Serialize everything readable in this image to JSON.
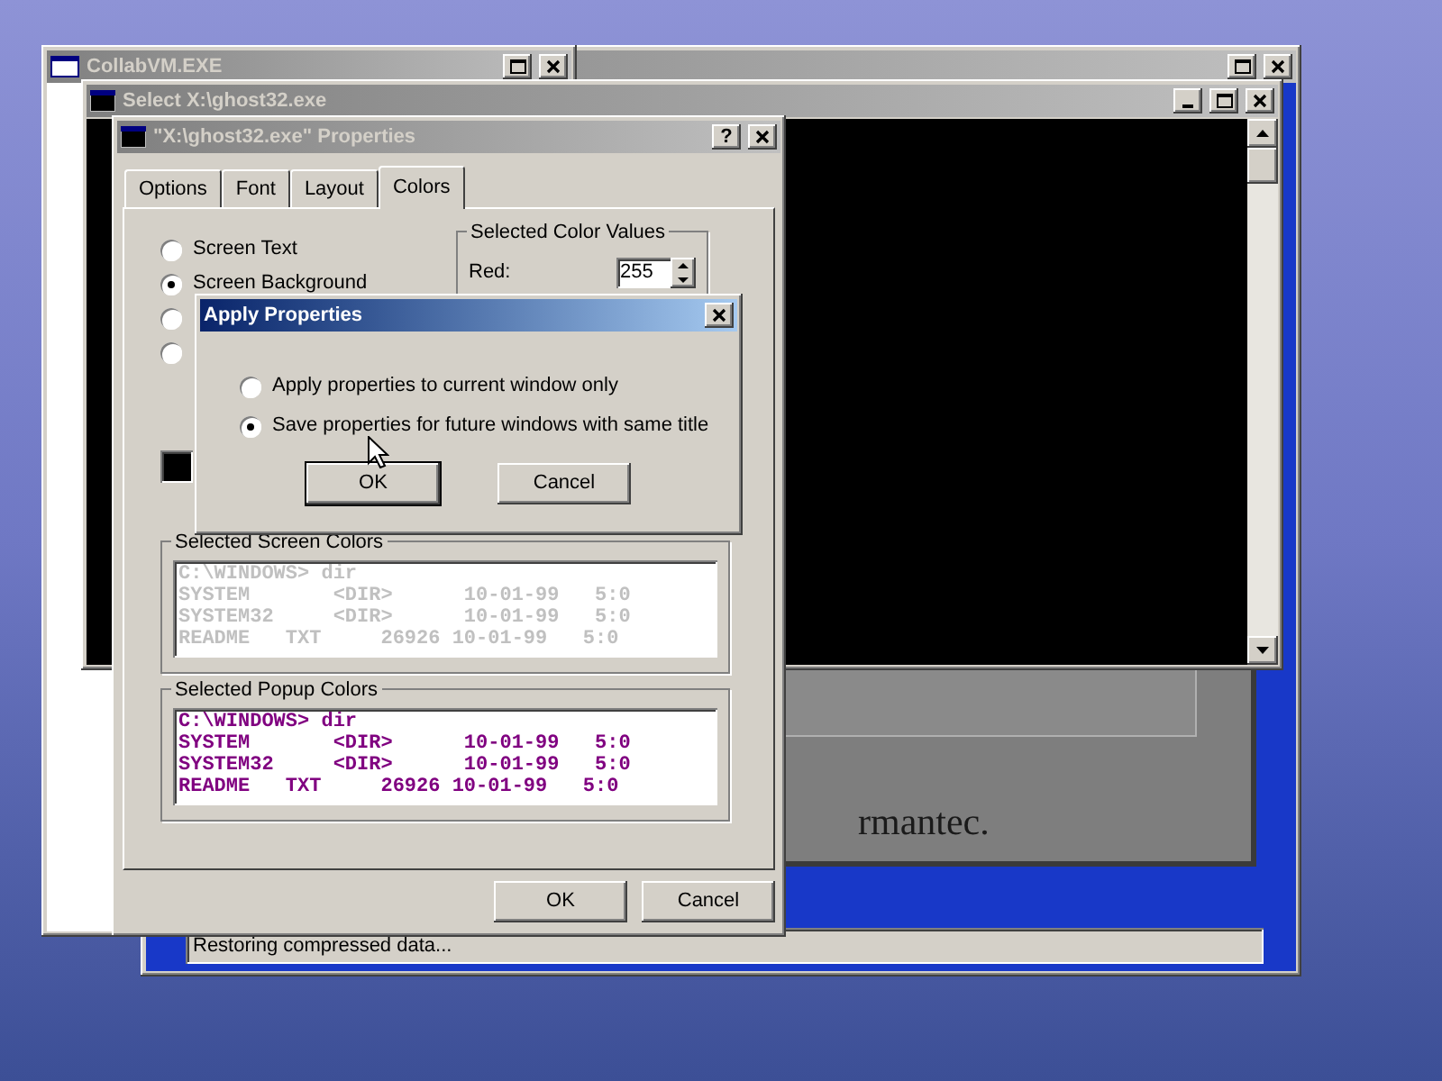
{
  "collab_window": {
    "title": "CollabVM.EXE",
    "active": false
  },
  "ghost_window": {
    "active": false,
    "logo_text": "rmantec.",
    "status": "Restoring compressed data..."
  },
  "console_window": {
    "title": "Select X:\\ghost32.exe",
    "active": false
  },
  "properties_window": {
    "title": "\"X:\\ghost32.exe\" Properties",
    "active": false,
    "help_button": "?",
    "tabs": [
      {
        "label": "Options",
        "selected": false
      },
      {
        "label": "Font",
        "selected": false
      },
      {
        "label": "Layout",
        "selected": false
      },
      {
        "label": "Colors",
        "selected": true
      }
    ],
    "color_targets": [
      {
        "label": "Screen Text",
        "selected": false
      },
      {
        "label": "Screen Background",
        "selected": true
      },
      {
        "selected": false
      },
      {
        "selected": false
      }
    ],
    "color_values": {
      "title": "Selected Color Values",
      "red_label": "Red:",
      "red_value": "255"
    },
    "palette": [
      {
        "color": "#000000"
      }
    ],
    "previews": [
      {
        "title": "Selected Screen Colors",
        "color": "#c0c0c0",
        "lines": [
          "C:\\WINDOWS> dir",
          "SYSTEM       <DIR>      10-01-99   5:0",
          "SYSTEM32     <DIR>      10-01-99   5:0",
          "README   TXT     26926 10-01-99   5:0"
        ]
      },
      {
        "title": "Selected Popup Colors",
        "color": "#800080",
        "lines": [
          "C:\\WINDOWS> dir",
          "SYSTEM       <DIR>      10-01-99   5:0",
          "SYSTEM32     <DIR>      10-01-99   5:0",
          "README   TXT     26926 10-01-99   5:0"
        ]
      }
    ],
    "buttons": [
      "OK",
      "Cancel"
    ]
  },
  "apply_dialog": {
    "title": "Apply Properties",
    "active": true,
    "options": [
      {
        "label": "Apply properties to current window only",
        "selected": false
      },
      {
        "label": "Save properties for future windows with same title",
        "selected": true
      }
    ],
    "buttons": [
      "OK",
      "Cancel"
    ]
  }
}
